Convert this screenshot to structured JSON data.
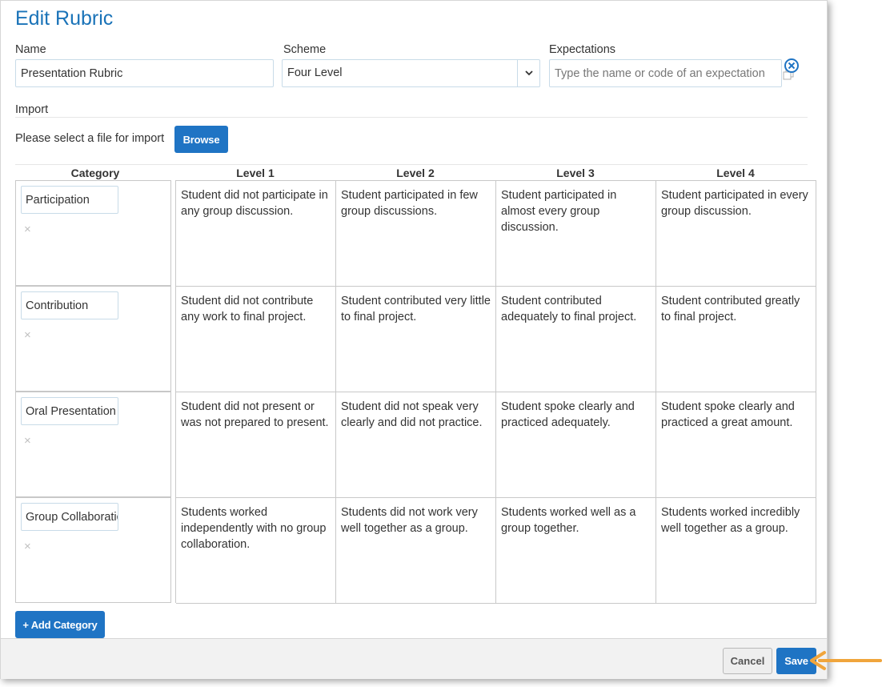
{
  "title": "Edit Rubric",
  "form": {
    "name_label": "Name",
    "name_value": "Presentation Rubric",
    "scheme_label": "Scheme",
    "scheme_value": "Four Level",
    "expectations_label": "Expectations",
    "expectations_placeholder": "Type the name or code of an expectation"
  },
  "import": {
    "section_label": "Import",
    "prompt": "Please select a file for import",
    "browse_label": "Browse"
  },
  "table": {
    "category_header": "Category",
    "level_headers": [
      "Level 1",
      "Level 2",
      "Level 3",
      "Level 4"
    ],
    "rows": [
      {
        "category": "Participation",
        "remove_icon": "×",
        "levels": [
          "Student did not participate in any group discussion.",
          "Student participated in few group discussions.",
          "Student participated in almost every group discussion.",
          "Student participated in every group discussion."
        ]
      },
      {
        "category": "Contribution",
        "remove_icon": "×",
        "levels": [
          "Student did not contribute any work to final project.",
          "Student contributed very little to final project.",
          "Student contributed adequately to final project.",
          "Student contributed greatly to final project."
        ]
      },
      {
        "category": "Oral Presentation",
        "remove_icon": "×",
        "levels": [
          "Student did not present or was not prepared to present.",
          "Student did not speak very clearly and did not practice.",
          "Student spoke clearly and practiced adequately.",
          "Student spoke clearly and practiced a great amount."
        ]
      },
      {
        "category": "Group Collaboration",
        "remove_icon": "×",
        "levels": [
          "Students worked independently with no group collaboration.",
          "Students did not work very well together as a group.",
          "Students worked well as a group together.",
          "Students worked incredibly well together as a group."
        ]
      }
    ]
  },
  "add_category_label": "+ Add Category",
  "footer": {
    "cancel_label": "Cancel",
    "save_label": "Save"
  },
  "icons": {
    "select_arrow": "chevron-down-icon",
    "expectation_clear": "circle-x-icon",
    "expectation_copy": "copy-icon",
    "callout": "orange-arrow-icon"
  },
  "colors": {
    "accent": "#1f74c4",
    "title": "#1a73b8",
    "callout_arrow": "#f0a53c"
  }
}
